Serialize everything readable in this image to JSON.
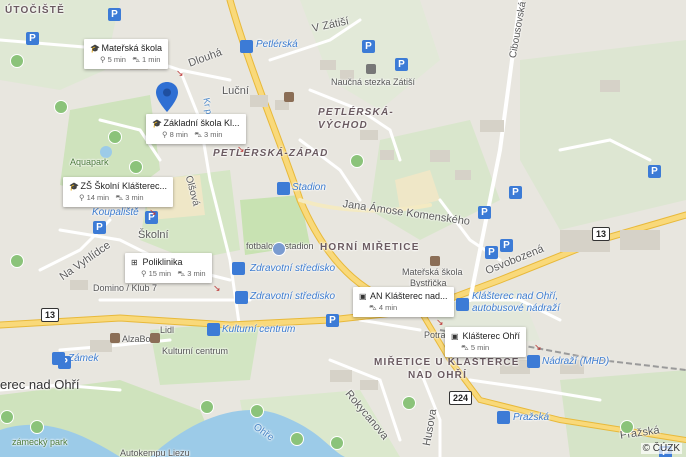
{
  "map": {
    "copyright": "© ČÚZK",
    "labels": {
      "utociste": "ÚTOČIŠTĚ",
      "v_zatisi": "V Zátiší",
      "cibousovska": "Cibousovská",
      "petlerska": "Petlérská",
      "dlouha": "Dlouhá",
      "lucni": "Luční",
      "naucna": "Naučná stezka Zátiší",
      "petlerska_vychod_1": "PETLÉRSKÁ-",
      "petlerska_vychod_2": "VÝCHOD",
      "petlerska_zapad": "PETLÉRSKÁ-ZÁPAD",
      "aquapark": "Aquapark",
      "stadion": "Stadion",
      "olsova": "Olšová",
      "kr_potok": "Kr potok",
      "koupaliste": "Koupaliště",
      "jana_amose": "Jana Ámose Komenského",
      "skolni": "Školní",
      "fotbalovy": "fotbalový stadion",
      "horni_mirtice": "HORNÍ MIŘETICE",
      "na_vyhlidce": "Na Vyhlídce",
      "zdravotni1": "Zdravotní středisko",
      "zdravotni2": "Zdravotní středisko",
      "materska_skola_bys_1": "Mateřská škola",
      "materska_skola_bys_2": "Bystřička",
      "osvobozena": "Osvobozená",
      "domino": "Domino / Klub 7",
      "klasterec_ohri_bus1": "Klášterec nad Ohří,",
      "klasterec_ohri_bus2": "autobusové nádraží",
      "lidl": "Lidl",
      "kulturni_centrum": "Kulturní centrum",
      "alzabox": "AlzaBox",
      "kulturni_centrum2": "Kulturní centrum",
      "potra": "Potra",
      "nadrazi": "Nádraží (MHD)",
      "zamek": "Zámek",
      "mirtice_u_kl_1": "MIŘETICE U KLÁŠTERCE",
      "mirtice_u_kl_2": "NAD OHŘÍ",
      "klasterec_town": "erec nad Ohří",
      "rokycanova": "Rokycanova",
      "husova": "Husova",
      "prazska1": "Pražská",
      "prazska2": "Pražská",
      "ohre": "Ohře",
      "zamecky_park": "zámecký park",
      "autokempu": "Autokempu Liezu"
    },
    "shields": {
      "r13_right": "13",
      "r13_left": "13",
      "r224": "224"
    },
    "parking_symbol": "P",
    "colors": {
      "water": "#9ccbe8",
      "green": "#c8e2b2",
      "road_major": "#f9d97a",
      "road_major_edge": "#e8b93a",
      "pin": "#2f6fd3"
    }
  },
  "cards": [
    {
      "icon": "school-icon",
      "title": "Mateřská škola",
      "walk": "5 min",
      "drive": "1 min"
    },
    {
      "icon": "school-icon",
      "title": "Základní škola Kl...",
      "walk": "8 min",
      "drive": "3 min"
    },
    {
      "icon": "school-icon",
      "title": "ZŠ Školní Klášterec...",
      "walk": "14 min",
      "drive": "3 min"
    },
    {
      "icon": "hospital-icon",
      "title": "Poliklinika",
      "walk": "15 min",
      "drive": "3 min"
    },
    {
      "icon": "bus-icon",
      "title": "AN Klášterec nad...",
      "drive": "4 min"
    },
    {
      "icon": "bus-icon",
      "title": "Klášterec Ohří",
      "drive": "5 min"
    }
  ]
}
